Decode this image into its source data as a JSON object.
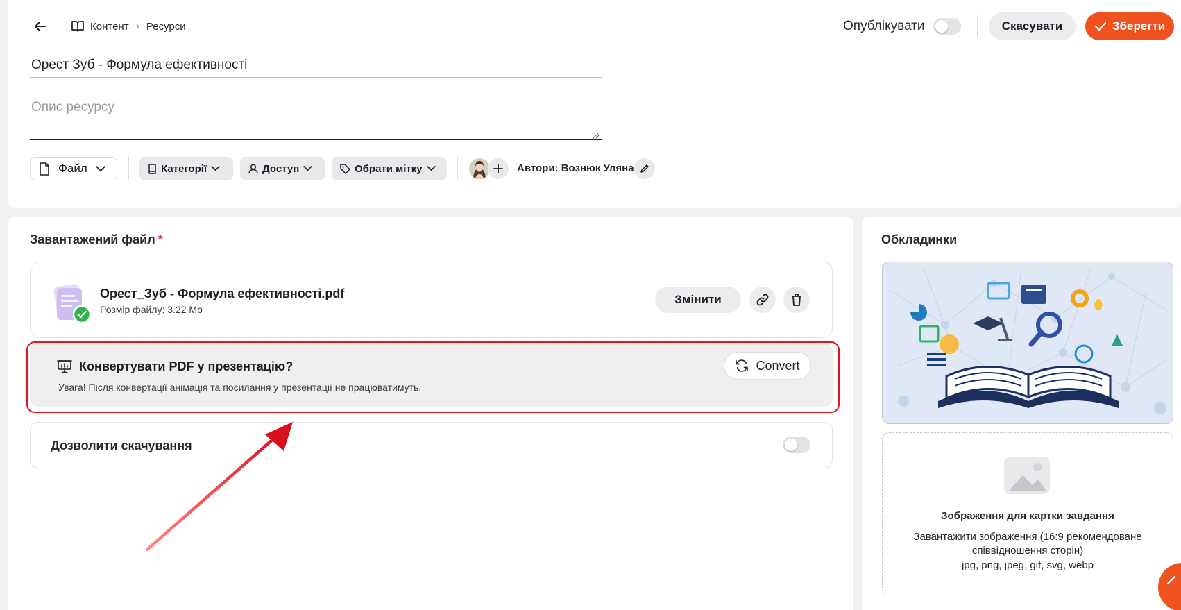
{
  "header": {
    "breadcrumbs": [
      "Контент",
      "Ресурси"
    ],
    "publish_label": "Опублікувати",
    "cancel_label": "Скасувати",
    "save_label": "Зберегти"
  },
  "resource": {
    "title": "Орест Зуб - Формула ефективності",
    "description_placeholder": "Опис ресурсу"
  },
  "toolbar": {
    "file_label": "Файл",
    "categories_label": "Категорії",
    "access_label": "Доступ",
    "tag_label": "Обрати мітку",
    "authors_text": "Автори: Вознюк Уляна"
  },
  "uploaded": {
    "section_title": "Завантажений файл",
    "required_mark": "*",
    "file_name": "Орест_Зуб - Формула ефективності.pdf",
    "file_size": "Розмір файлу: 3.22 Mb",
    "change_label": "Змінити"
  },
  "convert": {
    "title": "Конвертувати PDF у презентацію?",
    "warning": "Увага! Після конвертації анімація та посилання у презентації не працюватимуть.",
    "button_label": "Convert"
  },
  "download": {
    "label": "Дозволити скачування"
  },
  "covers": {
    "section_title": "Обкладинки",
    "upload_title": "Зображення для картки завдання",
    "upload_hint": "Завантажити зображення (16:9 рекомендоване співвідношення сторін)",
    "upload_formats": "jpg, png, jpeg, gif, svg, webp"
  },
  "colors": {
    "accent": "#f0521f",
    "highlight": "#e0141d"
  },
  "icons": [
    "arrow-left-icon",
    "book-open-icon",
    "chevron-right-icon",
    "check-icon",
    "file-icon",
    "chevron-down-icon",
    "book-icon",
    "user-icon",
    "tag-icon",
    "plus-icon",
    "pencil-icon",
    "link-icon",
    "trash-icon",
    "presentation-icon",
    "refresh-icon",
    "image-icon"
  ]
}
